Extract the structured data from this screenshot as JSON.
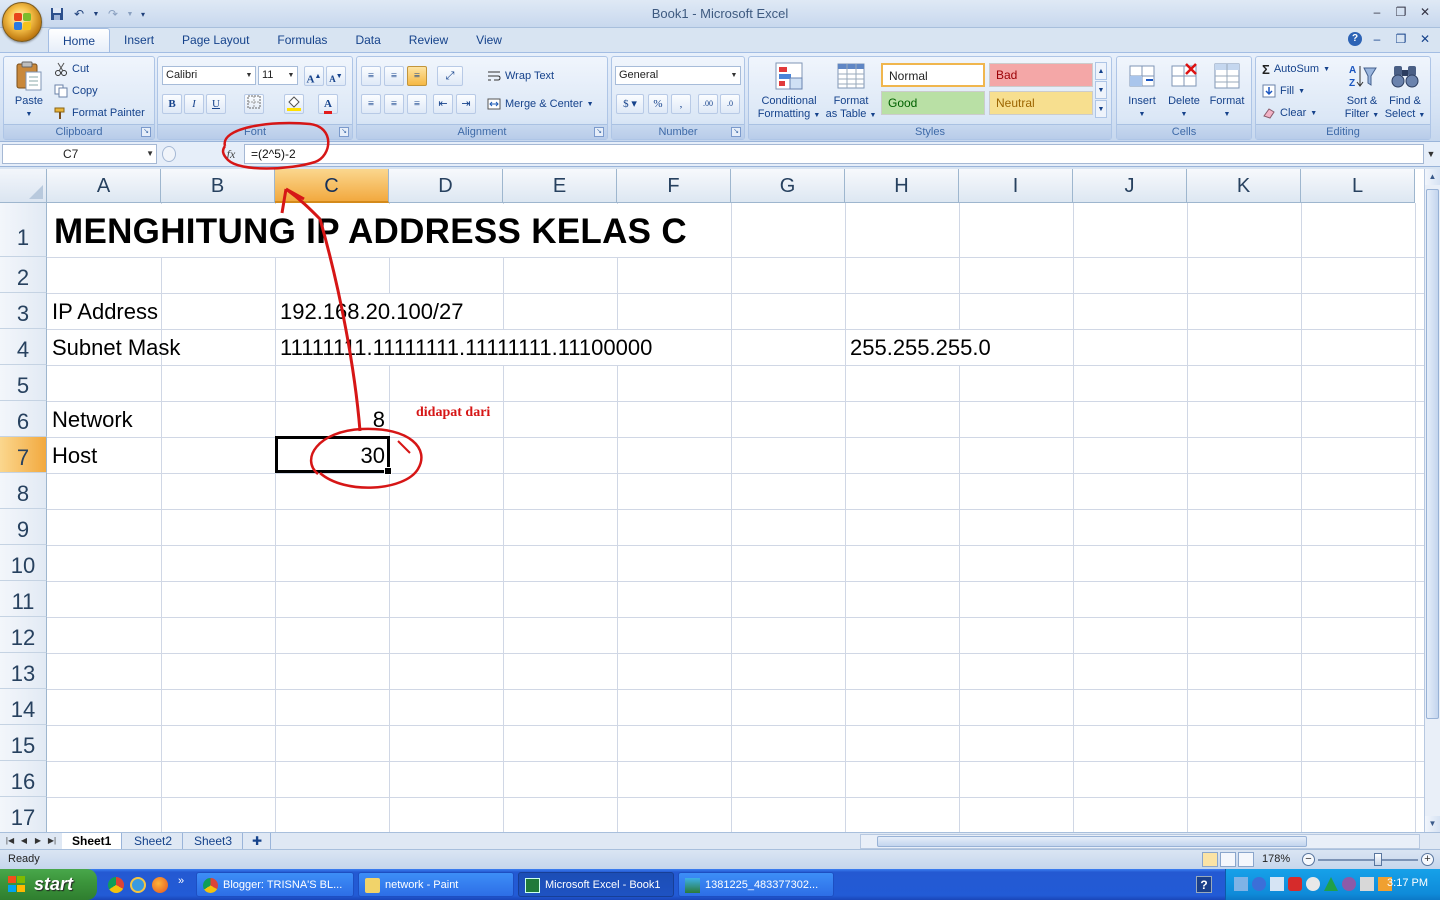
{
  "window": {
    "title": "Book1 - Microsoft Excel"
  },
  "ribbon_tabs": [
    "Home",
    "Insert",
    "Page Layout",
    "Formulas",
    "Data",
    "Review",
    "View"
  ],
  "ribbon": {
    "clipboard": {
      "paste": "Paste",
      "cut": "Cut",
      "copy": "Copy",
      "format_painter": "Format Painter",
      "label": "Clipboard"
    },
    "font": {
      "font_name": "Calibri",
      "font_size": "11",
      "label": "Font"
    },
    "alignment": {
      "wrap_text": "Wrap Text",
      "merge_center": "Merge & Center",
      "label": "Alignment"
    },
    "number": {
      "format": "General",
      "label": "Number"
    },
    "styles": {
      "conditional_formatting_1": "Conditional",
      "conditional_formatting_2": "Formatting",
      "format_as_table_1": "Format",
      "format_as_table_2": "as Table",
      "normal": "Normal",
      "bad": "Bad",
      "good": "Good",
      "neutral": "Neutral",
      "label": "Styles"
    },
    "cells": {
      "insert": "Insert",
      "delete": "Delete",
      "format": "Format",
      "label": "Cells"
    },
    "editing": {
      "autosum": "AutoSum",
      "fill": "Fill",
      "clear": "Clear",
      "sort_filter_1": "Sort &",
      "sort_filter_2": "Filter",
      "find_select_1": "Find &",
      "find_select_2": "Select",
      "label": "Editing"
    }
  },
  "formula_bar": {
    "name_box": "C7",
    "fx": "fx",
    "formula": "=(2^5)-2"
  },
  "grid": {
    "columns": [
      "A",
      "B",
      "C",
      "D",
      "E",
      "F",
      "G",
      "H",
      "I",
      "J",
      "K",
      "L"
    ],
    "rows": [
      "1",
      "2",
      "3",
      "4",
      "5",
      "6",
      "7",
      "8",
      "9",
      "10",
      "11",
      "12",
      "13",
      "14",
      "15",
      "16",
      "17"
    ],
    "cells": {
      "A1": "MENGHITUNG IP ADDRESS KELAS C",
      "A3": "IP Address",
      "C3": "192.168.20.100/27",
      "A4": "Subnet Mask",
      "C4": "11111111.11111111.11111111.11100000",
      "H4": "255.255.255.0",
      "A6": "Network",
      "C6": "8",
      "A7": "Host",
      "C7": "30"
    },
    "annotation": "didapat dari"
  },
  "sheets": [
    "Sheet1",
    "Sheet2",
    "Sheet3"
  ],
  "status": {
    "text": "Ready",
    "zoom": "178%"
  },
  "taskbar": {
    "start": "start",
    "tasks": [
      "Blogger: TRISNA'S BL...",
      "network - Paint",
      "Microsoft Excel - Book1",
      "1381225_483377302..."
    ],
    "clock": "3:17 PM"
  },
  "colors": {
    "accent_red": "#d61616",
    "selected_header": "#f2a93f",
    "ribbon_blue": "#15428b"
  }
}
